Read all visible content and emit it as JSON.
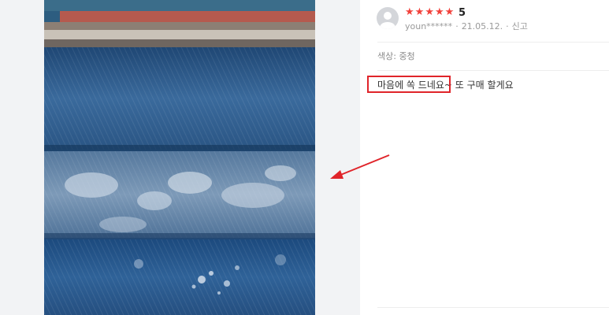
{
  "review": {
    "rating_stars": 5,
    "rating_value": "5",
    "reviewer_id": "youn******",
    "date": "21.05.12.",
    "report_label": "신고",
    "option_label": "색상: 중청",
    "text_highlighted": "마음에 쏙 드네요~",
    "text_rest": " 또 구매 할게요"
  },
  "colors": {
    "star": "#f2413b",
    "annotation": "#e0242a"
  }
}
